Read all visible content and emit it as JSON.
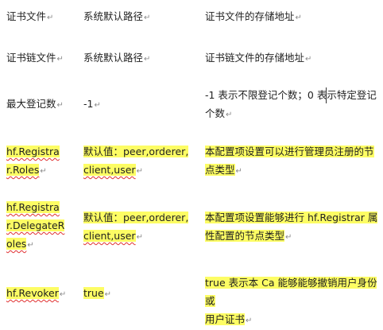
{
  "rows": [
    {
      "name": "证书文件",
      "default": "系统默认路径",
      "desc": "证书文件的存储地址"
    },
    {
      "name": "证书链文件",
      "default": "系统默认路径",
      "desc": "证书链文件的存储地址"
    },
    {
      "name": "最大登记数",
      "default": "-1",
      "desc": "-1 表示不限登记个数；0 表示特定登记个数"
    },
    {
      "name": "hf.Registrar.Roles",
      "name_lines": [
        "hf.Registra",
        "r.Roles"
      ],
      "default": "默认值：peer,orderer,client,user",
      "default_lines": [
        "默认值：peer,orderer,",
        "client,user"
      ],
      "desc": "本配置项设置可以进行管理员注册的节点类型"
    },
    {
      "name": "hf.Registrar.DelegateRoles",
      "name_lines": [
        "hf.Registra",
        "r.DelegateR",
        "oles"
      ],
      "default": "默认值：peer,orderer,client,user",
      "default_lines": [
        "默认值：peer,orderer,",
        "client,user"
      ],
      "desc": "本配置项设置能够进行 hf.Registrar 属性配置的节点类型"
    },
    {
      "name": "hf.Revoker",
      "default": "true",
      "desc": "true 表示本 Ca 能够能够撤销用户身份或用户证书"
    }
  ],
  "desc_lines": {
    "r2": [
      "-1 表示不限登记个数；0 表示特定登记",
      "个数"
    ],
    "r3": [
      "本配置项设置可以进行管理员注册的节",
      "点类型"
    ],
    "r4": [
      "本配置项设置能够进行 hf.Registrar 属",
      "性配置的节点类型"
    ],
    "r5": [
      "true 表示本 Ca 能够能够撤销用户身份或",
      "用户证书"
    ]
  },
  "paragraph_mark": "↵",
  "colors": {
    "highlight": "#fdfd64",
    "spellcheck": "#e03030"
  }
}
